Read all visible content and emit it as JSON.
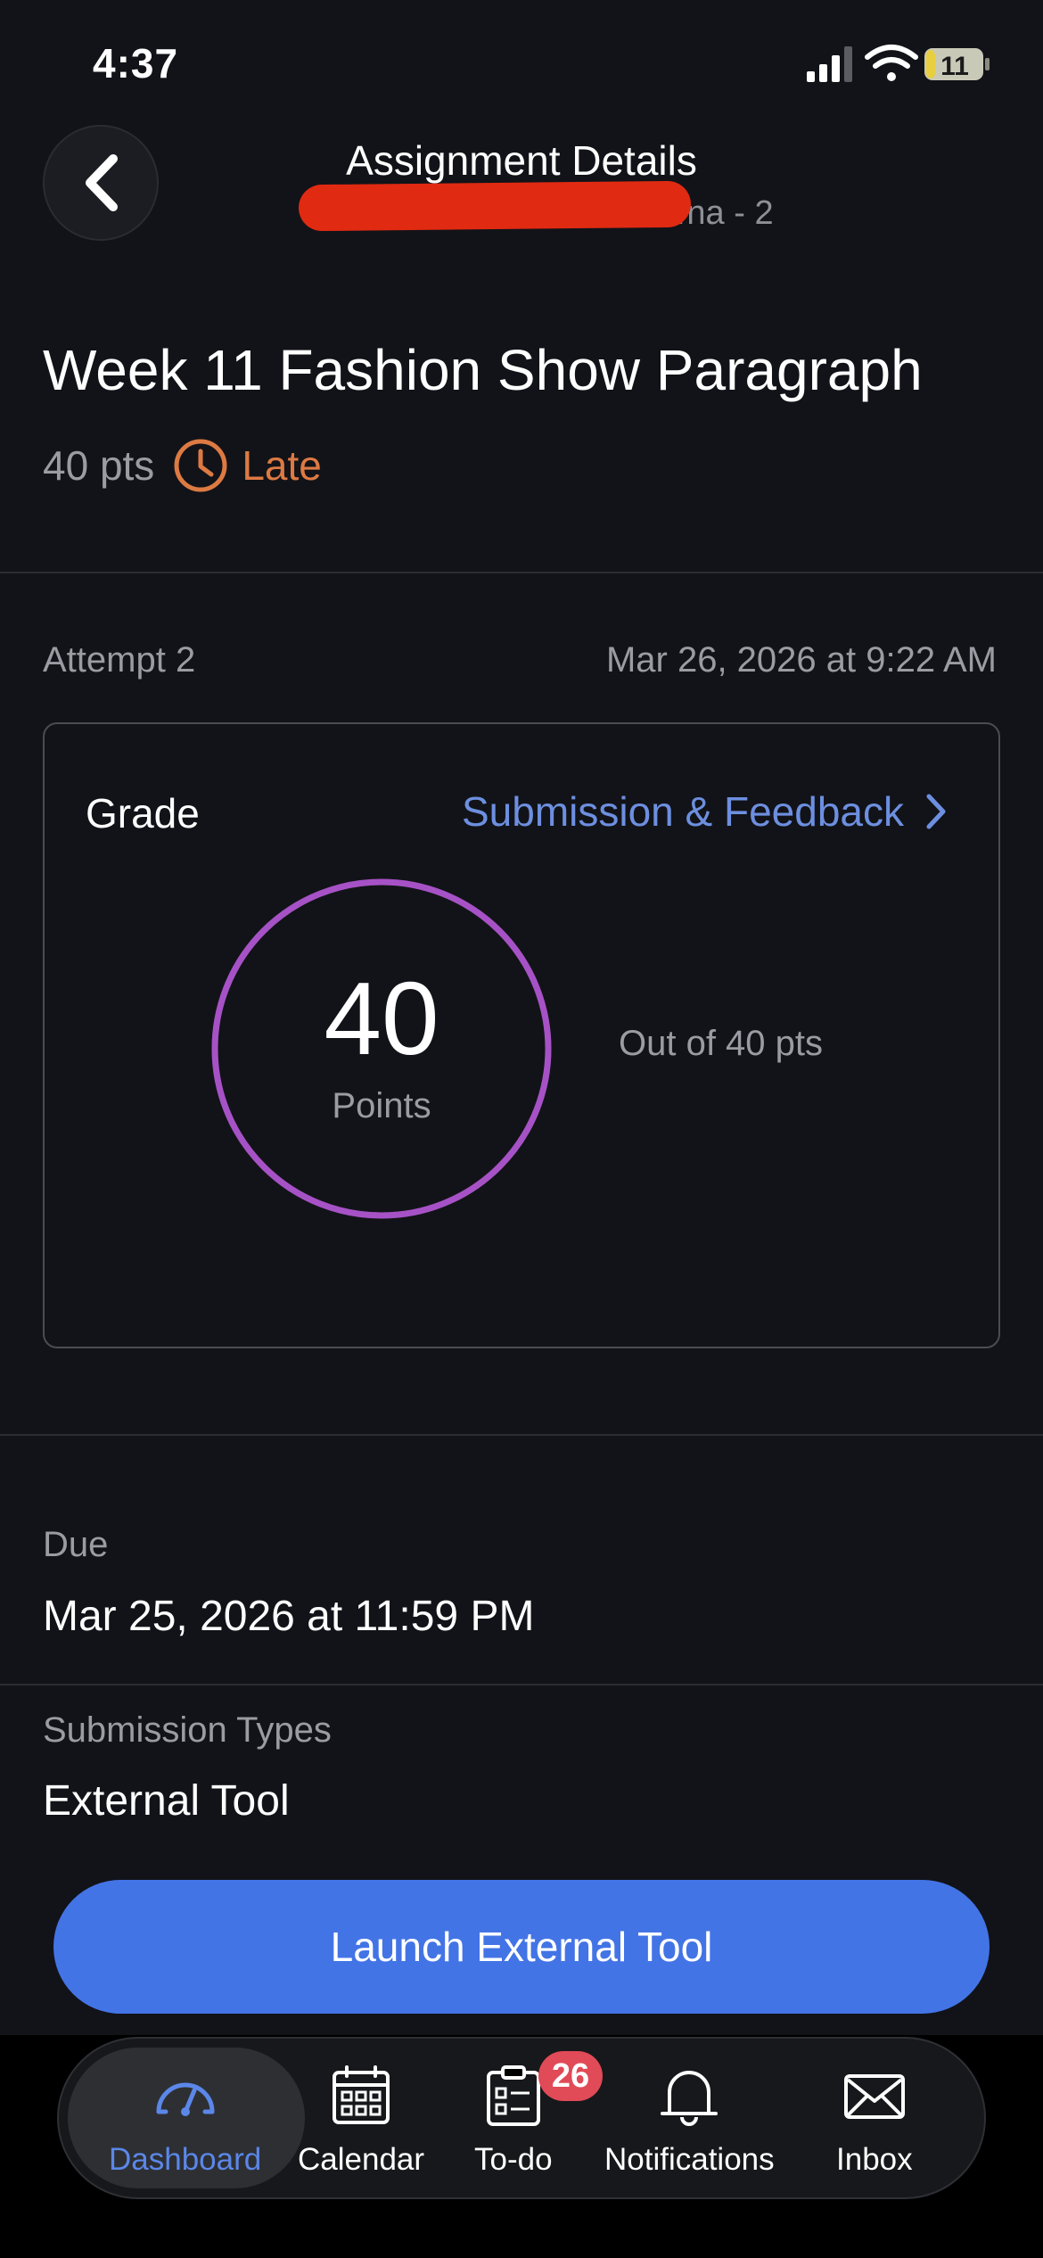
{
  "status_bar": {
    "time": "4:37",
    "battery": "11",
    "icons": [
      "cellular-signal-icon",
      "wifi-icon",
      "battery-icon"
    ]
  },
  "header": {
    "title": "Assignment Details",
    "subtitle_visible_fragment": "…na - 2"
  },
  "assignment": {
    "title": "Week 11 Fashion Show Paragraph",
    "points": "40 pts",
    "status": "Late"
  },
  "attempt": {
    "label": "Attempt 2",
    "date": "Mar 26, 2026 at 9:22 AM"
  },
  "grade": {
    "label": "Grade",
    "link": "Submission & Feedback",
    "value": "40",
    "unit": "Points",
    "out_of": "Out of 40 pts",
    "fraction": 1.0
  },
  "due": {
    "label": "Due",
    "value": "Mar 25, 2026 at 11:59 PM"
  },
  "submission_types": {
    "label": "Submission Types",
    "value": "External Tool"
  },
  "launch_button": "Launch External Tool",
  "tab_bar": {
    "items": [
      {
        "label": "Dashboard",
        "icon": "dashboard-icon",
        "active": true
      },
      {
        "label": "Calendar",
        "icon": "calendar-icon",
        "active": false
      },
      {
        "label": "To-do",
        "icon": "todo-icon",
        "active": false,
        "badge": "26"
      },
      {
        "label": "Notifications",
        "icon": "bell-icon",
        "active": false
      },
      {
        "label": "Inbox",
        "icon": "mail-icon",
        "active": false
      }
    ]
  },
  "colors": {
    "background": "#121318",
    "accent_blue": "#4374e6",
    "link_blue": "#6d8fe0",
    "late_orange": "#dd7a43",
    "grade_ring": "#a652c6",
    "badge_red": "#e14a57",
    "redaction": "#e02a12"
  }
}
